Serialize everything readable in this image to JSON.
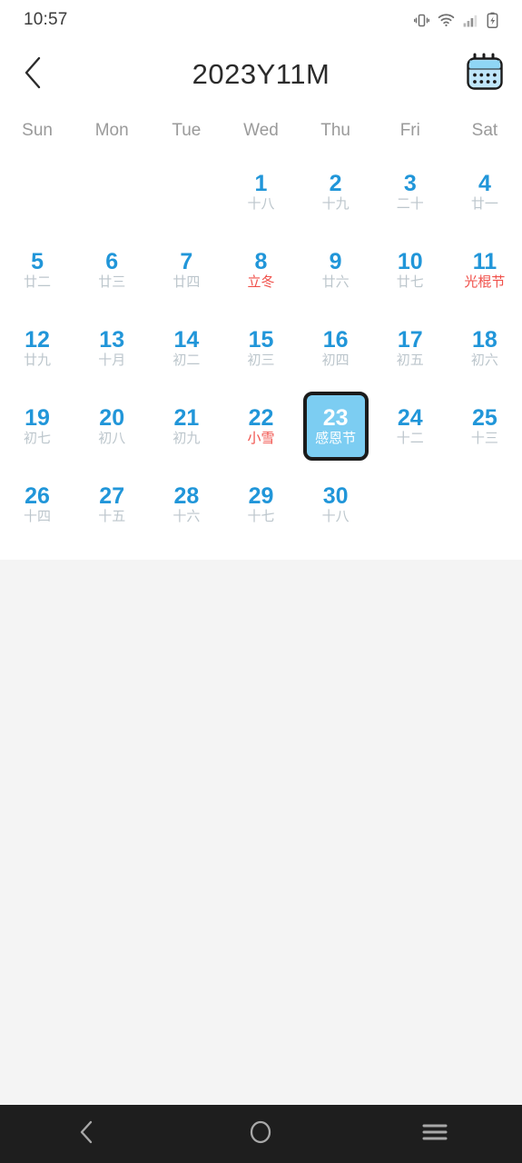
{
  "status_bar": {
    "time": "10:57",
    "icons": [
      "vibrate-icon",
      "wifi-icon",
      "signal-icon",
      "battery-charging-icon"
    ]
  },
  "header": {
    "back_icon": "chevron-left-icon",
    "title": "2023Y11M",
    "calendar_icon": "calendar-icon"
  },
  "colors": {
    "accent_blue": "#2196d9",
    "selected_fill": "#7ccdf2",
    "festival_red": "#f0504a",
    "lunar_gray": "#bcc6cc",
    "weekday_gray": "#9a9a9a",
    "page_bg": "#f4f4f4",
    "nav_bg": "#1e1e1e"
  },
  "calendar": {
    "weekdays": [
      "Sun",
      "Mon",
      "Tue",
      "Wed",
      "Thu",
      "Fri",
      "Sat"
    ],
    "leading_blanks": 3,
    "selected_day": 23,
    "days": [
      {
        "num": "1",
        "sub": "十八",
        "festival": false
      },
      {
        "num": "2",
        "sub": "十九",
        "festival": false
      },
      {
        "num": "3",
        "sub": "二十",
        "festival": false
      },
      {
        "num": "4",
        "sub": "廿一",
        "festival": false
      },
      {
        "num": "5",
        "sub": "廿二",
        "festival": false
      },
      {
        "num": "6",
        "sub": "廿三",
        "festival": false
      },
      {
        "num": "7",
        "sub": "廿四",
        "festival": false
      },
      {
        "num": "8",
        "sub": "立冬",
        "festival": true
      },
      {
        "num": "9",
        "sub": "廿六",
        "festival": false
      },
      {
        "num": "10",
        "sub": "廿七",
        "festival": false
      },
      {
        "num": "11",
        "sub": "光棍节",
        "festival": true
      },
      {
        "num": "12",
        "sub": "廿九",
        "festival": false
      },
      {
        "num": "13",
        "sub": "十月",
        "festival": false
      },
      {
        "num": "14",
        "sub": "初二",
        "festival": false
      },
      {
        "num": "15",
        "sub": "初三",
        "festival": false
      },
      {
        "num": "16",
        "sub": "初四",
        "festival": false
      },
      {
        "num": "17",
        "sub": "初五",
        "festival": false
      },
      {
        "num": "18",
        "sub": "初六",
        "festival": false
      },
      {
        "num": "19",
        "sub": "初七",
        "festival": false
      },
      {
        "num": "20",
        "sub": "初八",
        "festival": false
      },
      {
        "num": "21",
        "sub": "初九",
        "festival": false
      },
      {
        "num": "22",
        "sub": "小雪",
        "festival": true
      },
      {
        "num": "23",
        "sub": "感恩节",
        "festival": false
      },
      {
        "num": "24",
        "sub": "十二",
        "festival": false
      },
      {
        "num": "25",
        "sub": "十三",
        "festival": false
      },
      {
        "num": "26",
        "sub": "十四",
        "festival": false
      },
      {
        "num": "27",
        "sub": "十五",
        "festival": false
      },
      {
        "num": "28",
        "sub": "十六",
        "festival": false
      },
      {
        "num": "29",
        "sub": "十七",
        "festival": false
      },
      {
        "num": "30",
        "sub": "十八",
        "festival": false
      }
    ]
  },
  "navbar": {
    "back_icon": "nav-back-icon",
    "home_icon": "nav-home-icon",
    "recents_icon": "nav-recents-icon"
  }
}
